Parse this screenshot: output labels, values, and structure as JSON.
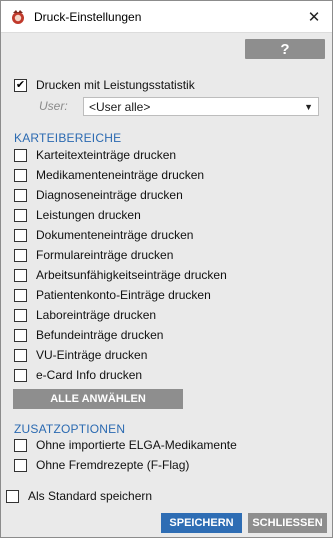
{
  "window": {
    "title": "Druck-Einstellungen",
    "close_glyph": "✕"
  },
  "help_button": {
    "label": "?"
  },
  "stats": {
    "label": "Drucken mit Leistungsstatistik",
    "checked": true
  },
  "user": {
    "label": "User:",
    "value": "<User alle>"
  },
  "karteibereiche": {
    "title": "KARTEIBEREICHE",
    "items": [
      {
        "label": "Karteitexteinträge drucken",
        "checked": false
      },
      {
        "label": "Medikamenteneinträge drucken",
        "checked": false
      },
      {
        "label": "Diagnoseneinträge drucken",
        "checked": false
      },
      {
        "label": "Leistungen drucken",
        "checked": false
      },
      {
        "label": "Dokumenteneinträge drucken",
        "checked": false
      },
      {
        "label": "Formulareinträge drucken",
        "checked": false
      },
      {
        "label": "Arbeitsunfähigkeitseinträge drucken",
        "checked": false
      },
      {
        "label": "Patientenkonto-Einträge drucken",
        "checked": false
      },
      {
        "label": "Laboreinträge drucken",
        "checked": false
      },
      {
        "label": "Befundeinträge drucken",
        "checked": false
      },
      {
        "label": "VU-Einträge drucken",
        "checked": false
      },
      {
        "label": "e-Card Info drucken",
        "checked": false
      }
    ],
    "select_all_label": "ALLE ANWÄHLEN"
  },
  "zusatzoptionen": {
    "title": "ZUSATZOPTIONEN",
    "items": [
      {
        "label": "Ohne importierte ELGA-Medikamente",
        "checked": false
      },
      {
        "label": "Ohne Fremdrezepte (F-Flag)",
        "checked": false
      }
    ]
  },
  "standard": {
    "label": "Als Standard speichern",
    "checked": false
  },
  "buttons": {
    "save": "SPEICHERN",
    "close": "SCHLIESSEN"
  }
}
